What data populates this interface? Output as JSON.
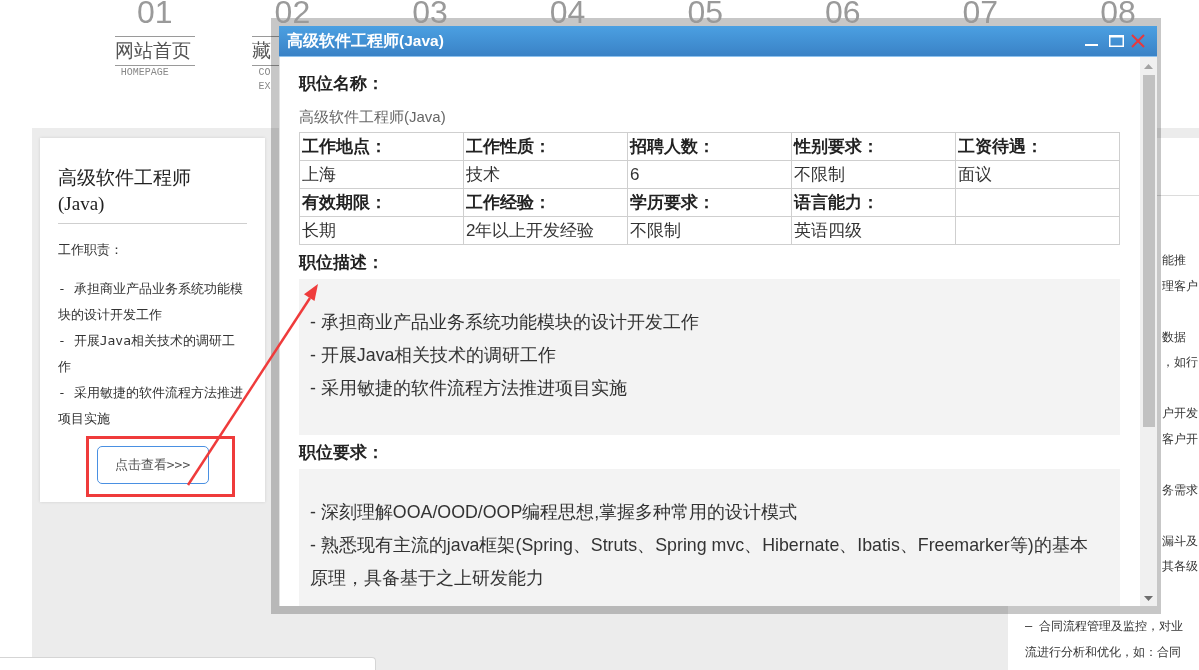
{
  "nav": [
    {
      "number": "01",
      "label": "网站首页",
      "sublabel_lines": [
        "HOMEPAGE"
      ]
    },
    {
      "number": "02",
      "label": "藏",
      "sublabel_lines": [
        "CO",
        "EX"
      ]
    },
    {
      "number": "03"
    },
    {
      "number": "04"
    },
    {
      "number": "05"
    },
    {
      "number": "06"
    },
    {
      "number": "07"
    },
    {
      "number": "08"
    }
  ],
  "job_card": {
    "title": "高级软件工程师(Java)",
    "section_label": "工作职责：",
    "lines": [
      "- 承担商业产品业务系统功能模块的设计开发工作",
      "- 开展Java相关技术的调研工作",
      "- 采用敏捷的软件流程方法推进项目实施"
    ],
    "button": "点击查看>>>"
  },
  "side_card": {
    "clipped_paragraphs": [
      [
        "能推",
        "理客户"
      ],
      [
        "数据",
        "，如行"
      ],
      [
        "户开发",
        "客户开"
      ],
      [
        "务需求"
      ],
      [
        "漏斗及",
        "其各级"
      ]
    ],
    "paragraphs": [
      [
        "– 合同流程管理及监控，对业",
        "流进行分析和优化，如：合同"
      ]
    ]
  },
  "dialog": {
    "title": "高级软件工程师(Java)",
    "sections": [
      {
        "kind": "field",
        "heading": "职位名称：",
        "value": "高级软件工程师(Java)"
      },
      {
        "kind": "table",
        "rows": [
          {
            "kind": "label",
            "cells": [
              "工作地点：",
              "工作性质：",
              "招聘人数：",
              "性别要求：",
              "工资待遇："
            ]
          },
          {
            "kind": "value",
            "cells": [
              "上海",
              "技术",
              "6",
              "不限制",
              "面议"
            ]
          },
          {
            "kind": "label",
            "cells": [
              "有效期限：",
              "工作经验：",
              "学历要求：",
              "语言能力："
            ]
          },
          {
            "kind": "value",
            "cells": [
              "长期",
              "2年以上开发经验",
              "不限制",
              "英语四级"
            ]
          }
        ]
      },
      {
        "kind": "list",
        "heading": "职位描述：",
        "lines": [
          "- 承担商业产品业务系统功能模块的设计开发工作",
          "- 开展Java相关技术的调研工作",
          "- 采用敏捷的软件流程方法推进项目实施"
        ]
      },
      {
        "kind": "list",
        "heading": "职位要求：",
        "lines": [
          "- 深刻理解OOA/OOD/OOP编程思想,掌握多种常用的设计模式",
          "- 熟悉现有主流的java框架(Spring、Struts、Spring mvc、Hibernate、Ibatis、Freemarker等)的基本原理，具备基于之上研发能力"
        ]
      }
    ]
  }
}
